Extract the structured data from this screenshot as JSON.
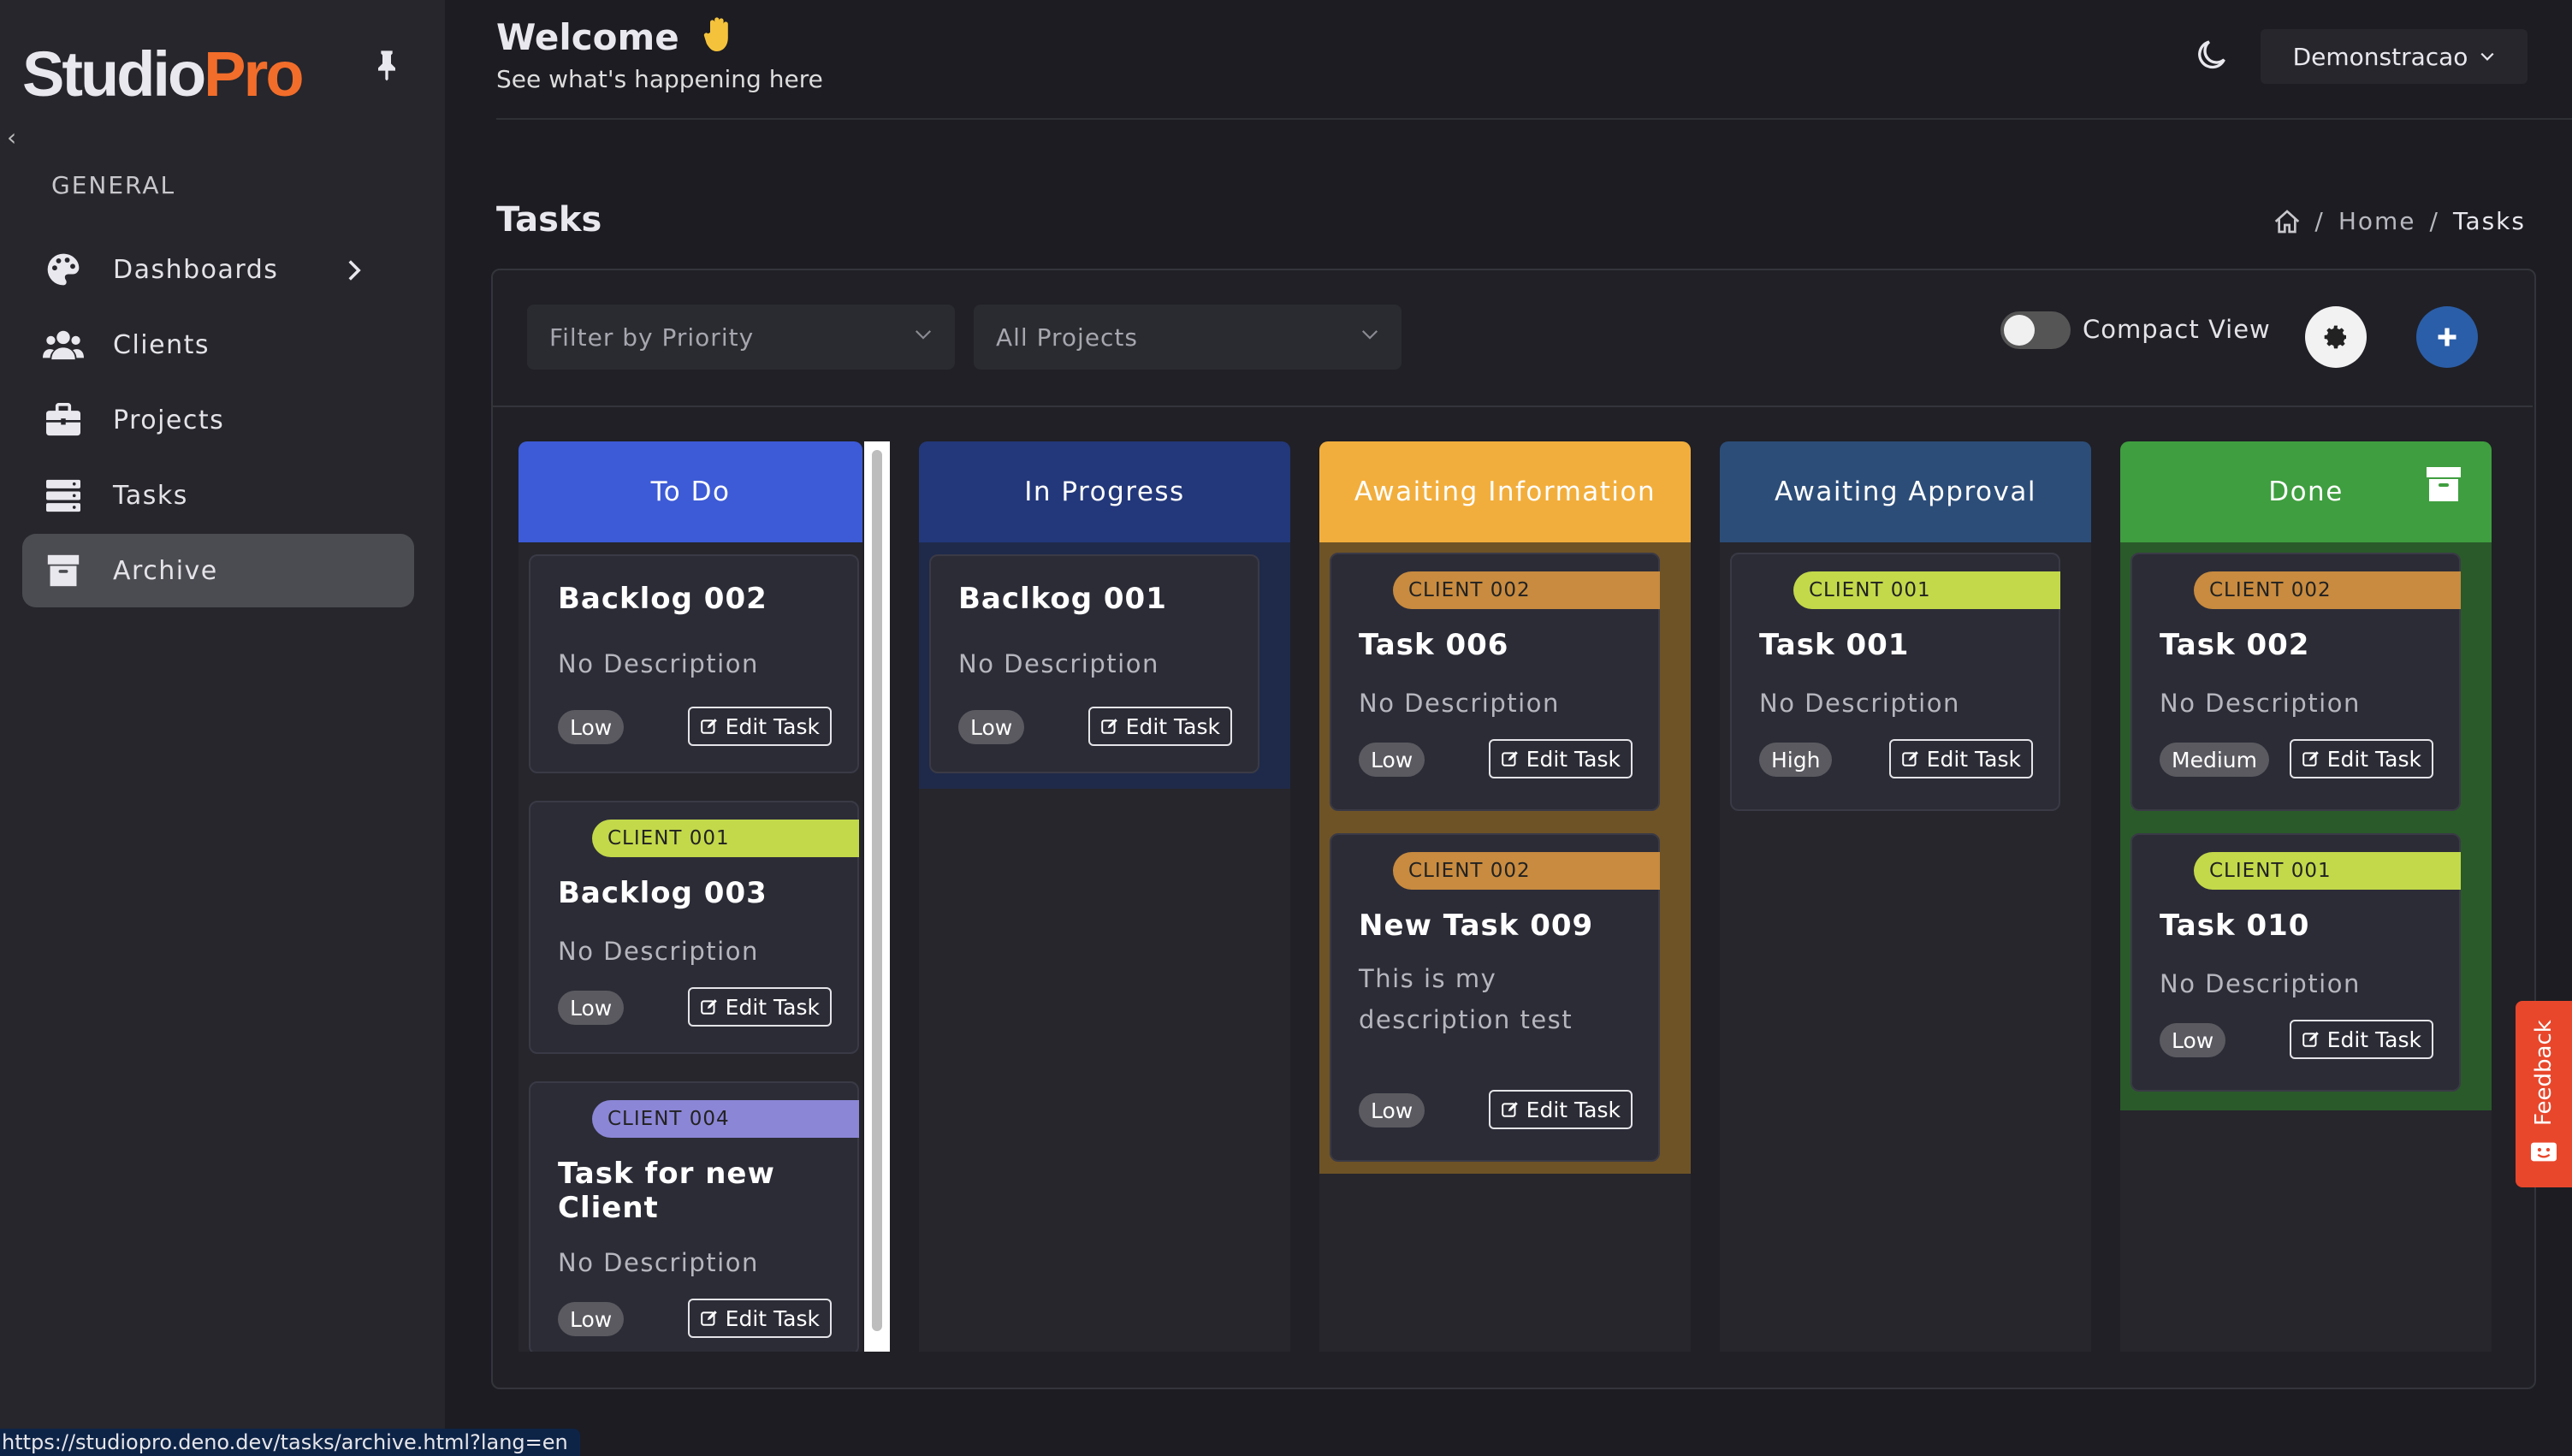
{
  "sidebar": {
    "logo_a": "Studio",
    "logo_b": "Pro",
    "section": "GENERAL",
    "items": [
      {
        "label": "Dashboards",
        "icon": "palette-icon"
      },
      {
        "label": "Clients",
        "icon": "users-icon"
      },
      {
        "label": "Projects",
        "icon": "briefcase-icon"
      },
      {
        "label": "Tasks",
        "icon": "server-icon"
      },
      {
        "label": "Archive",
        "icon": "archive-icon",
        "active": true
      }
    ]
  },
  "header": {
    "welcome": "Welcome",
    "subtitle": "See what's happening here",
    "account": "Demonstracao"
  },
  "page": {
    "title": "Tasks",
    "breadcrumb": {
      "home": "Home",
      "sep": "/",
      "current": "Tasks"
    }
  },
  "toolbar": {
    "priority_placeholder": "Filter by Priority",
    "projects_placeholder": "All Projects",
    "compact_label": "Compact View"
  },
  "columns": [
    {
      "title": "To Do",
      "color": "#3d5bd6",
      "cards": [
        {
          "tag": "",
          "title": "Backlog 002",
          "desc": "No Description",
          "priority": "Low",
          "edit": "Edit Task"
        },
        {
          "tag": "CLIENT 001",
          "title": "Backlog 003",
          "desc": "No Description",
          "priority": "Low",
          "edit": "Edit Task"
        },
        {
          "tag": "CLIENT 004",
          "title": "Task for new Client",
          "desc": "No Description",
          "priority": "Low",
          "edit": "Edit Task"
        }
      ]
    },
    {
      "title": "In Progress",
      "color": "#23387a",
      "cards": [
        {
          "tag": "",
          "title": "Baclkog 001",
          "desc": "No Description",
          "priority": "Low",
          "edit": "Edit Task"
        }
      ]
    },
    {
      "title": "Awaiting Information",
      "color": "#f2ae3c",
      "cards": [
        {
          "tag": "CLIENT 002",
          "title": "Task 006",
          "desc": "No Description",
          "priority": "Low",
          "edit": "Edit Task"
        },
        {
          "tag": "CLIENT 002",
          "title": "New Task 009",
          "desc": "This is my description test",
          "priority": "Low",
          "edit": "Edit Task"
        }
      ]
    },
    {
      "title": "Awaiting Approval",
      "color": "#2c4d78",
      "cards": [
        {
          "tag": "CLIENT 001",
          "title": "Task 001",
          "desc": "No Description",
          "priority": "High",
          "edit": "Edit Task"
        }
      ]
    },
    {
      "title": "Done",
      "color": "#3f9e3f",
      "cards": [
        {
          "tag": "CLIENT 002",
          "title": "Task 002",
          "desc": "No Description",
          "priority": "Medium",
          "edit": "Edit Task"
        },
        {
          "tag": "CLIENT 001",
          "title": "Task 010",
          "desc": "No Description",
          "priority": "Low",
          "edit": "Edit Task"
        }
      ]
    }
  ],
  "tag_colors": {
    "CLIENT 001": "#c3d94a",
    "CLIENT 002": "#c88b3f",
    "CLIENT 004": "#8b86d6"
  },
  "feedback": "Feedback",
  "status_url": "https://studiopro.deno.dev/tasks/archive.html?lang=en"
}
